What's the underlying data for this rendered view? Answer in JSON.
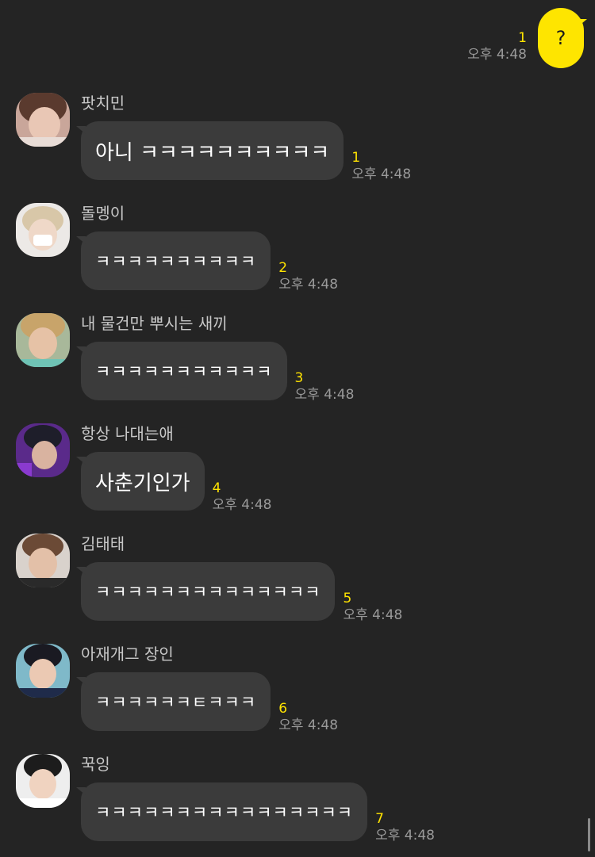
{
  "my_message": {
    "text": "?",
    "unread": "1",
    "time": "오후 4:48",
    "bubble_color": "#fee500"
  },
  "messages": [
    {
      "sender": "팟치민",
      "text": "아니 ㅋㅋㅋㅋㅋㅋㅋㅋㅋㅋ",
      "unread": "1",
      "time": "오후 4:48",
      "avatar": "profile-photo-1"
    },
    {
      "sender": "돌멩이",
      "text": "ㅋㅋㅋㅋㅋㅋㅋㅋㅋㅋ",
      "unread": "2",
      "time": "오후 4:48",
      "avatar": "profile-photo-2"
    },
    {
      "sender": "내 물건만 뿌시는 새끼",
      "text": "ㅋㅋㅋㅋㅋㅋㅋㅋㅋㅋㅋ",
      "unread": "3",
      "time": "오후 4:48",
      "avatar": "profile-photo-3"
    },
    {
      "sender": "항상 나대는애",
      "text": "사춘기인가",
      "unread": "4",
      "time": "오후 4:48",
      "avatar": "profile-photo-4"
    },
    {
      "sender": "김태태",
      "text": "ㅋㅋㅋㅋㅋㅋㅋㅋㅋㅋㅋㅋㅋㅋ",
      "unread": "5",
      "time": "오후 4:48",
      "avatar": "profile-photo-5"
    },
    {
      "sender": "아재개그 장인",
      "text": "ㅋㅋㅋㅋㅋㅋㅌㅋㅋㅋ",
      "unread": "6",
      "time": "오후 4:48",
      "avatar": "profile-photo-6"
    },
    {
      "sender": "꾹잉",
      "text": "ㅋㅋㅋㅋㅋㅋㅋㅋㅋㅋㅋㅋㅋㅋㅋㅋ",
      "unread": "7",
      "time": "오후 4:48",
      "avatar": "profile-photo-7"
    }
  ],
  "colors": {
    "background": "#242424",
    "bubble": "#3b3b3b",
    "unread": "#ffe300",
    "time": "#9a9a9a"
  }
}
